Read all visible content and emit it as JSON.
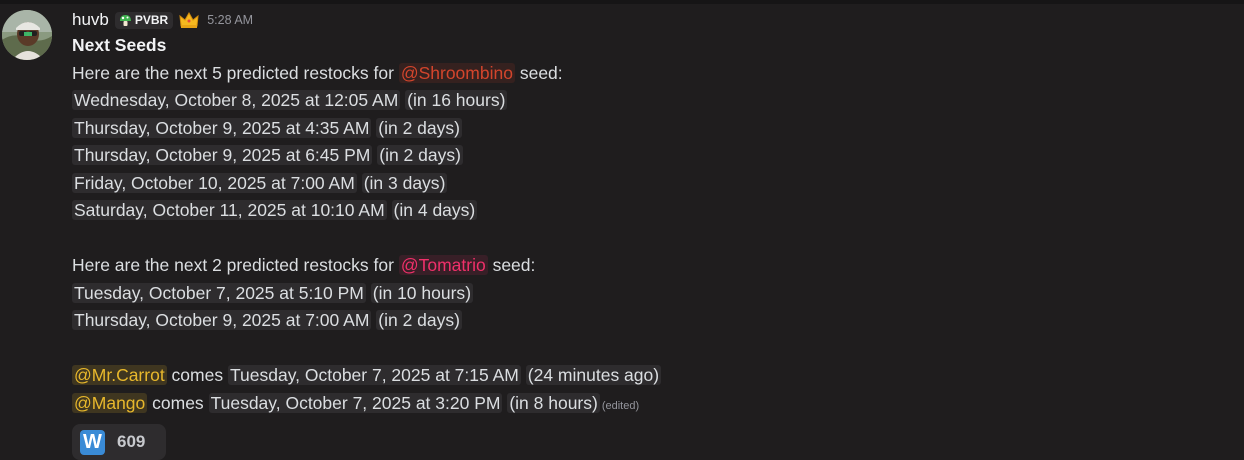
{
  "message": {
    "username": "huvb",
    "tag": "PVBR",
    "timestamp": "5:28 AM",
    "title": "Next Seeds",
    "shroom": {
      "intro_before": "Here are the next 5 predicted restocks for ",
      "mention": "@Shroombino",
      "intro_after": " seed:",
      "restocks": [
        {
          "time": "Wednesday, October 8, 2025 at 12:05 AM",
          "rel": "in 16 hours"
        },
        {
          "time": "Thursday, October 9, 2025 at 4:35 AM",
          "rel": "in 2 days"
        },
        {
          "time": "Thursday, October 9, 2025 at 6:45 PM",
          "rel": "in 2 days"
        },
        {
          "time": "Friday, October 10, 2025 at 7:00 AM",
          "rel": "in 3 days"
        },
        {
          "time": "Saturday, October 11, 2025 at 10:10 AM",
          "rel": "in 4 days"
        }
      ]
    },
    "toma": {
      "intro_before": "Here are the next 2 predicted restocks for ",
      "mention": "@Tomatrio",
      "intro_after": " seed:",
      "restocks": [
        {
          "time": "Tuesday, October 7, 2025 at 5:10 PM",
          "rel": "in 10 hours"
        },
        {
          "time": "Thursday, October 9, 2025 at 7:00 AM",
          "rel": "in 2 days"
        }
      ]
    },
    "carrot": {
      "mention": "@Mr.Carrot",
      "word": " comes ",
      "time": "Tuesday, October 7, 2025 at 7:15 AM",
      "rel": "24 minutes ago"
    },
    "mango": {
      "mention": "@Mango",
      "word": " comes ",
      "time": "Tuesday, October 7, 2025 at 3:20 PM",
      "rel": "in 8 hours",
      "edited": "(edited)"
    }
  },
  "reaction": {
    "emoji_letter": "W",
    "count": "609"
  },
  "icons": {
    "tag_icon": "mushroom-icon",
    "crown": "crown-icon",
    "reaction_emoji": "w-emoji"
  },
  "colors": {
    "background": "#1f1d1e",
    "text": "#dbdee1",
    "timestamp_chip": "#2e2c2e",
    "shroombino_mention": "#d3452c",
    "tomatrio_mention": "#f0306a",
    "gold_mention": "#e8b82c",
    "reaction_emoji_bg": "#3a8bd6"
  }
}
